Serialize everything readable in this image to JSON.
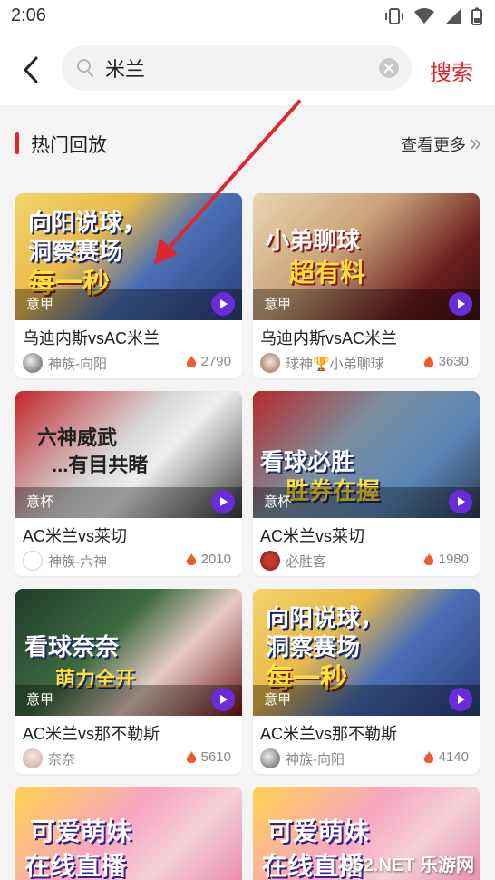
{
  "status": {
    "time": "2:06"
  },
  "search": {
    "query": "米兰",
    "button": "搜索"
  },
  "section": {
    "title": "热门回放",
    "more": "查看更多"
  },
  "cards": [
    {
      "thumb_lines": [
        "向阳说球，",
        "洞察赛场",
        "每一秒"
      ],
      "league": "意甲",
      "title": "乌迪内斯vsAC米兰",
      "author": "神族-向阳",
      "heat": "2790"
    },
    {
      "thumb_lines": [
        "小弟聊球",
        "超有料"
      ],
      "league": "意甲",
      "title": "乌迪内斯vsAC米兰",
      "author": "球神🏆小弟聊球",
      "heat": "3630"
    },
    {
      "thumb_lines": [
        "六神威武",
        "...有目共睹"
      ],
      "league": "意杯",
      "title": "AC米兰vs莱切",
      "author": "神族-六神",
      "heat": "2010"
    },
    {
      "thumb_lines": [
        "看球必胜",
        "胜券在握"
      ],
      "league": "意杯",
      "title": "AC米兰vs莱切",
      "author": "必胜客",
      "heat": "1980"
    },
    {
      "thumb_lines": [
        "看球奈奈",
        "萌力全开"
      ],
      "league": "意甲",
      "title": "AC米兰vs那不勒斯",
      "author": "奈奈",
      "heat": "5610"
    },
    {
      "thumb_lines": [
        "向阳说球，",
        "洞察赛场",
        "每一秒"
      ],
      "league": "意甲",
      "title": "AC米兰vs那不勒斯",
      "author": "神族-向阳",
      "heat": "4140"
    },
    {
      "thumb_lines": [
        "可爱萌妹",
        "在线直播"
      ]
    },
    {
      "thumb_lines": [
        "可爱萌妹",
        "在线直播"
      ]
    }
  ],
  "watermark": "962.NET 乐游网",
  "colors": {
    "accent": "#e0262f",
    "play": "#6a2bd9",
    "flame": "#f05a28"
  }
}
